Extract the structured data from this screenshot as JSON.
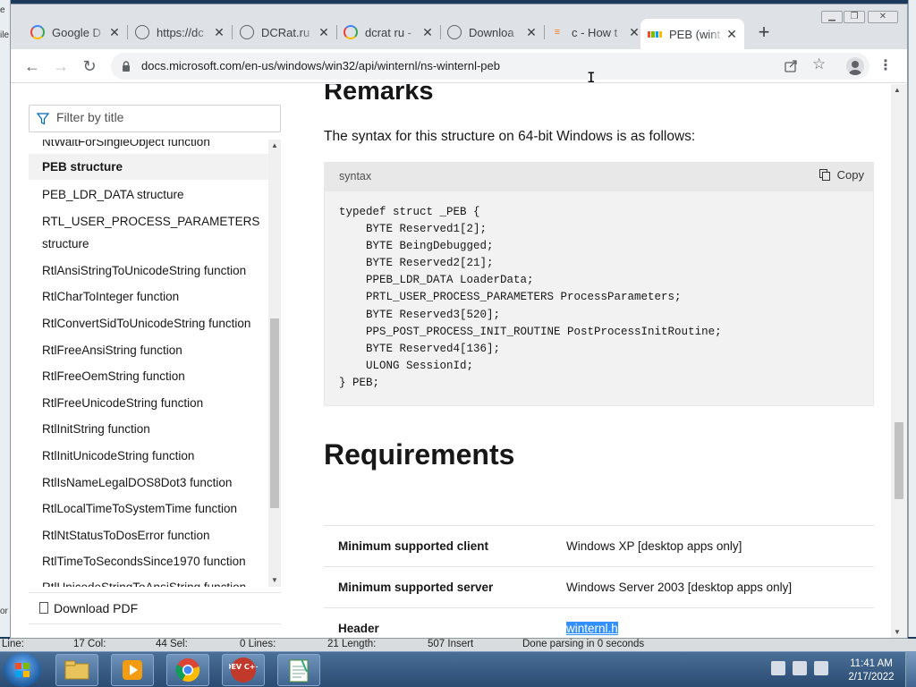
{
  "desktop": {
    "left_fragments": [
      "e",
      "ile",
      "or"
    ]
  },
  "browser": {
    "tabs": [
      {
        "title": "Google D",
        "favicon": "google-icon"
      },
      {
        "title": "https://dc",
        "favicon": "globe-icon"
      },
      {
        "title": "DCRat.ru",
        "favicon": "globe-icon"
      },
      {
        "title": "dcrat ru -",
        "favicon": "google-icon"
      },
      {
        "title": "Downloa",
        "favicon": "globe-icon"
      },
      {
        "title": "c - How t",
        "favicon": "stackoverflow-icon"
      },
      {
        "title": "PEB (wint",
        "favicon": "microsoft-icon",
        "active": true
      }
    ],
    "url": "docs.microsoft.com/en-us/windows/win32/api/winternl/ns-winternl-peb"
  },
  "sidebar": {
    "filter_placeholder": "Filter by title",
    "toc": [
      "NtWaitForSingleObject function",
      "PEB structure",
      "PEB_LDR_DATA structure",
      "RTL_USER_PROCESS_PARAMETERS",
      "structure",
      "RtlAnsiStringToUnicodeString function",
      "RtlCharToInteger function",
      "RtlConvertSidToUnicodeString function",
      "RtlFreeAnsiString function",
      "RtlFreeOemString function",
      "RtlFreeUnicodeString function",
      "RtlInitString function",
      "RtlInitUnicodeString function",
      "RtlIsNameLegalDOS8Dot3 function",
      "RtlLocalTimeToSystemTime function",
      "RtlNtStatusToDosError function",
      "RtlTimeToSecondsSince1970 function",
      "RtlUnicodeStringToAnsiString function"
    ],
    "selected": "PEB structure",
    "download_pdf": "Download PDF"
  },
  "main": {
    "remarks_heading": "Remarks",
    "remarks_text": "The syntax for this structure on 64-bit Windows is as follows:",
    "code_lang": "syntax",
    "copy_label": "Copy",
    "code_lines": [
      "typedef struct _PEB {",
      "    BYTE Reserved1[2];",
      "    BYTE BeingDebugged;",
      "    BYTE Reserved2[21];",
      "    PPEB_LDR_DATA LoaderData;",
      "    PRTL_USER_PROCESS_PARAMETERS ProcessParameters;",
      "    BYTE Reserved3[520];",
      "    PPS_POST_PROCESS_INIT_ROUTINE PostProcessInitRoutine;",
      "    BYTE Reserved4[136];",
      "    ULONG SessionId;",
      "} PEB;"
    ],
    "requirements_heading": "Requirements",
    "requirements": [
      {
        "key": "Minimum supported client",
        "value": "Windows XP [desktop apps only]"
      },
      {
        "key": "Minimum supported server",
        "value": "Windows Server 2003 [desktop apps only]"
      },
      {
        "key": "Header",
        "value": "winternl.h"
      }
    ]
  },
  "statusbar": {
    "line": "Line:",
    "col": "17 Col:",
    "sel": "44 Sel:",
    "lines": "0 Lines:",
    "length": "21 Length:",
    "insert": "507 Insert",
    "message": "Done parsing in 0 seconds"
  },
  "taskbar": {
    "apps": [
      "file-explorer-icon",
      "media-player-icon",
      "chrome-icon",
      "dev-cpp-icon",
      "notepad-icon"
    ],
    "devcpp_label": "DEV C++",
    "clock_time": "11:41 AM",
    "clock_date": "2/17/2022"
  },
  "colors": {
    "selection": "#3390ff",
    "tabstrip": "#dee1e6",
    "taskbar": "#2a4b72"
  }
}
